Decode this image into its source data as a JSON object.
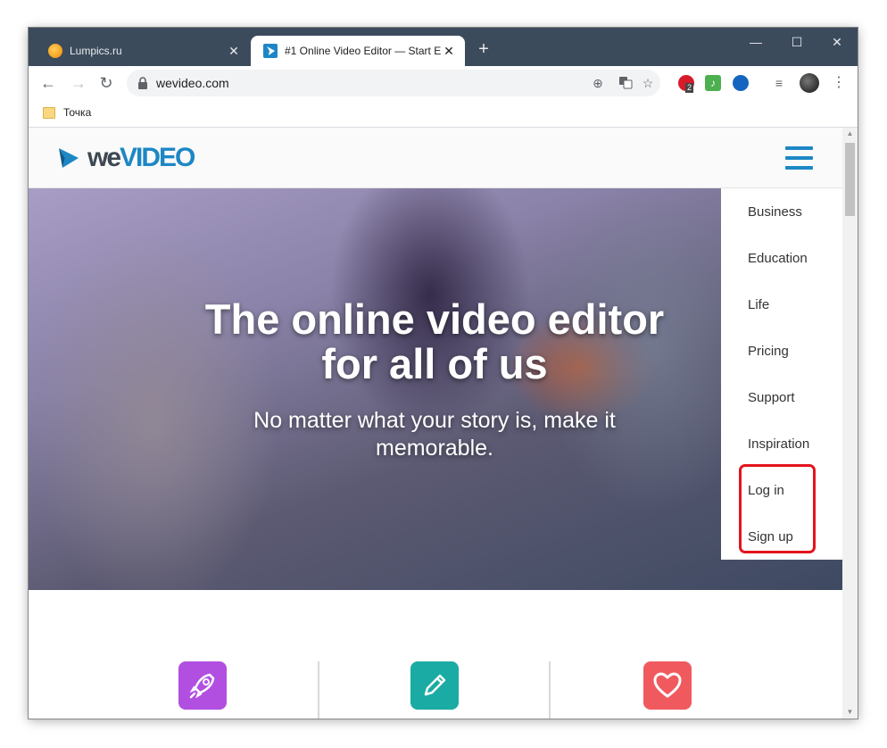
{
  "browser": {
    "tabs": [
      {
        "title": "Lumpics.ru",
        "favicon": "orange-favicon",
        "active": false,
        "close": "✕"
      },
      {
        "title": "#1 Online Video Editor — Start E",
        "favicon": "wevideo-favicon",
        "active": true,
        "close": "✕"
      }
    ],
    "new_tab": "+",
    "window_controls": {
      "minimize": "—",
      "maximize": "☐",
      "close": "✕"
    },
    "nav": {
      "back": "←",
      "forward": "→",
      "reload": "↻"
    },
    "url": "wevideo.com",
    "omnibox_icons": [
      "add-circle-icon",
      "translate-icon",
      "star-icon"
    ],
    "extension_badge": "2",
    "bookmarks": [
      {
        "label": "Точка"
      }
    ]
  },
  "site": {
    "logo": {
      "we": "we",
      "video": "VIDEO"
    },
    "hero": {
      "title": "The online video editor for all of us",
      "subtitle": "No matter what your story is, make it memorable."
    },
    "menu": [
      "Business",
      "Education",
      "Life",
      "Pricing",
      "Support",
      "Inspiration",
      "Log in",
      "Sign up"
    ],
    "features": [
      {
        "icon": "rocket-icon",
        "color": "#b14fe0"
      },
      {
        "icon": "pencil-icon",
        "color": "#1aaba4"
      },
      {
        "icon": "heart-icon",
        "color": "#f05a5f"
      }
    ]
  },
  "colors": {
    "brand_blue": "#1d87c5",
    "highlight_red": "#e3141d",
    "tabstrip": "#3c4b5c"
  }
}
